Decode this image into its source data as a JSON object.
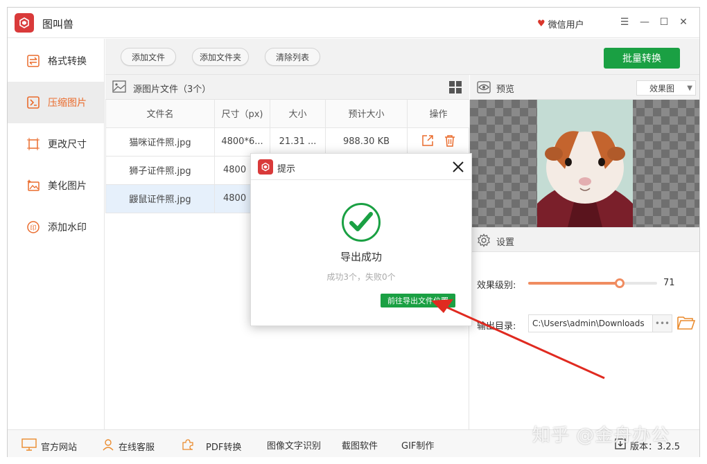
{
  "app": {
    "title": "图叫兽",
    "user": "微信用户"
  },
  "sidebar": {
    "items": [
      {
        "label": "格式转换",
        "icon": "convert-icon"
      },
      {
        "label": "压缩图片",
        "icon": "compress-icon"
      },
      {
        "label": "更改尺寸",
        "icon": "resize-icon"
      },
      {
        "label": "美化图片",
        "icon": "beautify-icon"
      },
      {
        "label": "添加水印",
        "icon": "watermark-icon"
      }
    ],
    "active": 1
  },
  "toolbar": {
    "add_file": "添加文件",
    "add_folder": "添加文件夹",
    "clear_list": "清除列表",
    "batch_convert": "批量转换"
  },
  "files": {
    "header": "源图片文件（3个）",
    "columns": [
      "文件名",
      "尺寸（px)",
      "大小",
      "预计大小",
      "操作"
    ],
    "rows": [
      {
        "name": "猫咪证件照.jpg",
        "size_px": "4800*6...",
        "size": "21.31 ...",
        "est": "988.30 KB"
      },
      {
        "name": "狮子证件照.jpg",
        "size_px": "4800",
        "size": "",
        "est": ""
      },
      {
        "name": "鼹鼠证件照.jpg",
        "size_px": "4800",
        "size": "",
        "est": ""
      }
    ]
  },
  "preview": {
    "title": "预览",
    "mode": "效果图"
  },
  "settings": {
    "title": "设置",
    "level_label": "效果级别:",
    "level_value": "71",
    "level_fraction": 0.71,
    "output_label": "输出目录:",
    "output_dir": "C:\\Users\\admin\\Downloads",
    "more": "•••"
  },
  "dialog": {
    "title": "提示",
    "message": "导出成功",
    "sub": "成功3个，失败0个",
    "goto": "前往导出文件位置"
  },
  "bottom": {
    "website": "官方网站",
    "service": "在线客服",
    "pdf": "PDF转换",
    "ocr": "图像文字识别",
    "screenshot": "截图软件",
    "gif": "GIF制作",
    "version": "版本：3.2.5"
  },
  "watermark": "知乎 @金舟办公",
  "colors": {
    "accent": "#ea6b2c",
    "green": "#1aa043",
    "logo": "#d93a3a",
    "arrow": "#e02a20"
  }
}
